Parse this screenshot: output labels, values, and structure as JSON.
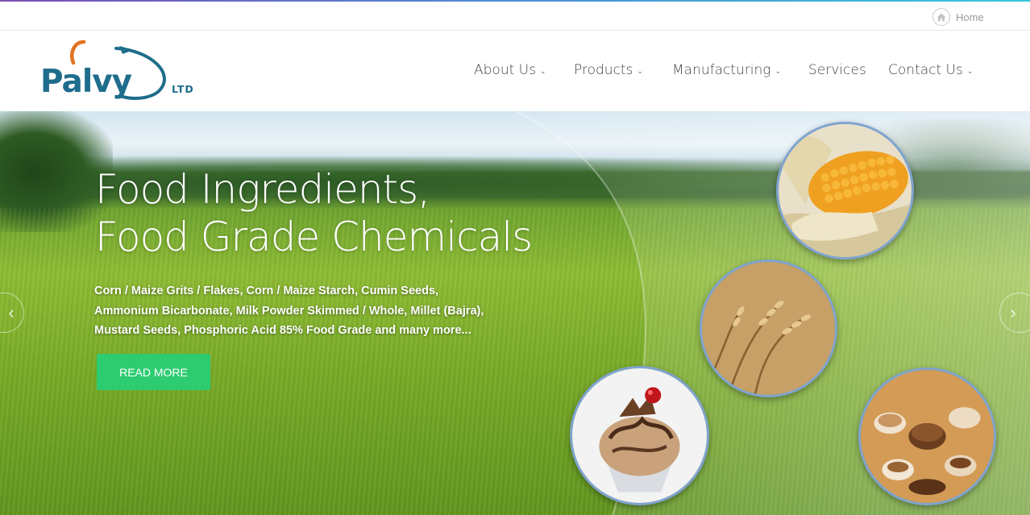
{
  "topbar": {
    "home_label": "Home",
    "home_icon": "home-icon"
  },
  "brand": {
    "name": "Palvy",
    "suffix": "LTD",
    "primary_color": "#1f6d8c",
    "accent_color": "#e2721e"
  },
  "nav": {
    "items": [
      {
        "label": "About Us",
        "has_dropdown": true
      },
      {
        "label": "Products",
        "has_dropdown": true
      },
      {
        "label": "Manufacturing",
        "has_dropdown": true
      },
      {
        "label": "Services",
        "has_dropdown": false
      },
      {
        "label": "Contact Us",
        "has_dropdown": true
      }
    ]
  },
  "hero": {
    "title_line1": "Food Ingredients,",
    "title_line2": "Food Grade Chemicals",
    "description_lines": [
      "Corn / Maize Grits / Flakes, Corn / Maize Starch, Cumin Seeds,",
      "Ammonium Bicarbonate, Milk Powder Skimmed / Whole, Millet (Bajra),",
      "Mustard Seeds, Phosphoric Acid 85% Food Grade and many more..."
    ],
    "cta_label": "READ MORE",
    "cta_color": "#2ecc71",
    "prev_arrow": "‹",
    "next_arrow": "›"
  },
  "colors": {
    "nav_text": "#444444",
    "circle_border": "#7fa3cf"
  }
}
